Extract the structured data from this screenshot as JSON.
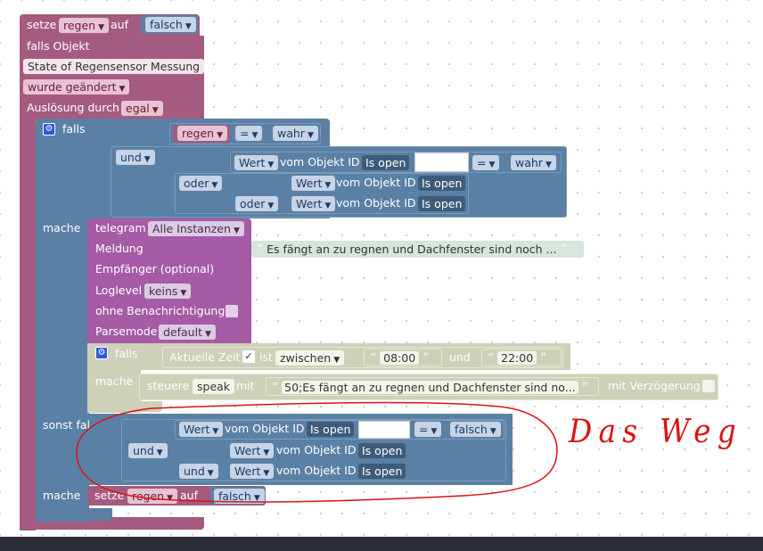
{
  "colors": {
    "variables": "#a55b80",
    "logic": "#5b80a5",
    "telegram": "#a55ba5",
    "timer": "#cfd0b8",
    "dark_bar": "#2b2f35",
    "red_annotation": "#dd1111"
  },
  "top_set": {
    "setze": "setze",
    "var": "regen",
    "auf": "auf",
    "value": "falsch"
  },
  "trigger": {
    "falls_objekt": "falls Objekt",
    "object_name": "State of Regensensor Messung",
    "changed": "wurde geändert",
    "ausloesung": "Auslösung durch",
    "egal": "egal"
  },
  "ifblock": {
    "falls": "falls",
    "cog": "gear-icon",
    "cond1": {
      "var": "regen",
      "op": "=",
      "value": "wahr"
    },
    "und": "und",
    "cond2": {
      "wert": "Wert",
      "vom": "vom Objekt ID",
      "isopen": "Is open",
      "op": "=",
      "value": "wahr"
    },
    "oder1": "oder",
    "row2": {
      "wert": "Wert",
      "vom": "vom Objekt ID",
      "isopen": "Is open"
    },
    "oder2": "oder",
    "row3": {
      "wert": "Wert",
      "vom": "vom Objekt ID",
      "isopen": "Is open"
    },
    "mache": "mache"
  },
  "telegram": {
    "label": "telegram",
    "instances": "Alle Instanzen",
    "meldung": "Meldung",
    "message": "Es fängt an zu regnen und Dachfenster sind noch ...",
    "empfaenger": "Empfänger (optional)",
    "loglevel": "Loglevel",
    "loglevel_value": "keins",
    "ohne": "ohne Benachrichtigung",
    "parsemode": "Parsemode",
    "parsemode_value": "default"
  },
  "timeblock": {
    "falls": "falls",
    "aktuelle": "Aktuelle Zeit",
    "ist": "ist",
    "zwischen": "zwischen",
    "t1": "08:00",
    "und": "und",
    "t2": "22:00",
    "mache": "mache",
    "steuere": "steuere",
    "speak": "speak",
    "mit": "mit",
    "speak_text": "50;Es fängt an zu regnen und Dachfenster sind no...",
    "verzoegerung": "mit Verzögerung"
  },
  "elseblock": {
    "sonst_falls": "sonst falls",
    "cond": {
      "wert": "Wert",
      "vom": "vom Objekt ID",
      "isopen": "Is open",
      "op": "=",
      "value": "falsch"
    },
    "und1": "und",
    "row2": {
      "wert": "Wert",
      "vom": "vom Objekt ID",
      "isopen": "Is open"
    },
    "und2": "und",
    "row3": {
      "wert": "Wert",
      "vom": "vom Objekt ID",
      "isopen": "Is open"
    },
    "mache": "mache",
    "set": {
      "setze": "setze",
      "var": "regen",
      "auf": "auf",
      "value": "falsch"
    }
  },
  "annotation": {
    "text": "Das Weg"
  }
}
